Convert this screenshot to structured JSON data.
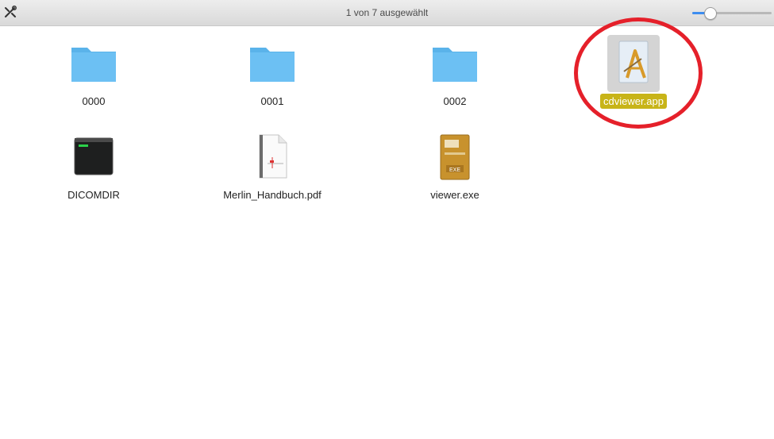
{
  "statusbar": {
    "selection_text": "1 von 7 ausgewählt",
    "tools_icon": "tools-icon",
    "zoom_level": 0.18
  },
  "files": [
    {
      "name": "0000",
      "icon": "folder-icon",
      "selected": false
    },
    {
      "name": "0001",
      "icon": "folder-icon",
      "selected": false
    },
    {
      "name": "0002",
      "icon": "folder-icon",
      "selected": false
    },
    {
      "name": "cdviewer.app",
      "icon": "application-icon",
      "selected": true
    },
    {
      "name": "DICOMDIR",
      "icon": "terminal-executable-icon",
      "selected": false
    },
    {
      "name": "Merlin_Handbuch.pdf",
      "icon": "pdf-document-icon",
      "selected": false
    },
    {
      "name": "viewer.exe",
      "icon": "exe-file-icon",
      "selected": false
    }
  ],
  "colors": {
    "folder": "#6cc0f3",
    "selection_label": "#c8b418",
    "annotation_ring": "#e5202a"
  }
}
